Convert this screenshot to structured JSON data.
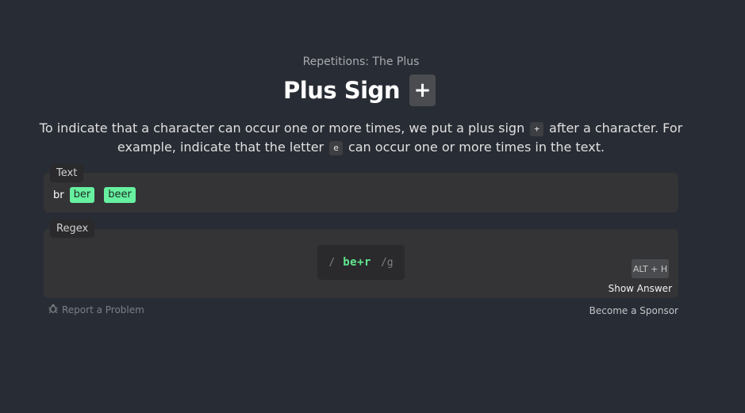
{
  "header": {
    "subtitle": "Repetitions: The Plus",
    "title": "Plus Sign",
    "badge": "+"
  },
  "description": {
    "part1": "To indicate that a character can occur one or more times, we put a plus sign",
    "code1": "+",
    "part2": "after a character. For example, indicate that the letter",
    "code2": "e",
    "part3": "can occur one or more times in the text."
  },
  "text_panel": {
    "label": "Text",
    "plain_word": "br",
    "matches": [
      "ber",
      "beer"
    ]
  },
  "regex_panel": {
    "label": "Regex",
    "open_slash": "/",
    "value": "be+r",
    "flags": "/g",
    "shortcut": "ALT + H",
    "show_answer": "Show Answer"
  },
  "footer": {
    "report": "Report a Problem",
    "sponsor": "Become a Sponsor"
  },
  "colors": {
    "background": "#282c34",
    "panel": "#343436",
    "match_highlight": "#66f0a0",
    "regex_text": "#5fe890"
  }
}
